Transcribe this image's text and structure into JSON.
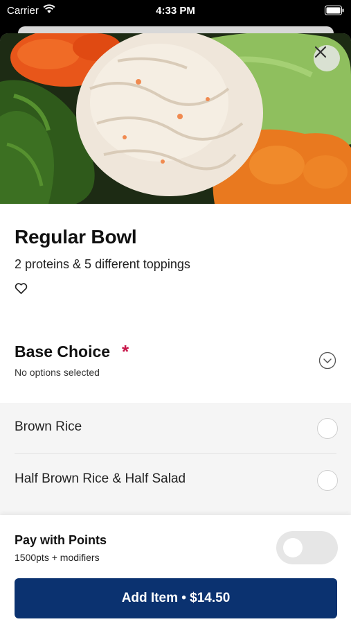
{
  "status_bar": {
    "carrier": "Carrier",
    "time": "4:33 PM"
  },
  "product": {
    "title": "Regular Bowl",
    "description": "2 proteins & 5 different toppings"
  },
  "base_choice": {
    "title": "Base Choice",
    "required_mark": "*",
    "subtitle": "No options selected",
    "options": [
      {
        "label": "Brown Rice",
        "selected": false
      },
      {
        "label": "Half Brown Rice & Half Salad",
        "selected": false
      }
    ]
  },
  "points": {
    "title": "Pay with Points",
    "subtitle": "1500pts + modifiers",
    "enabled": false
  },
  "add_button": {
    "label": "Add Item • $14.50"
  },
  "colors": {
    "primary": "#0b3270",
    "required": "#c8174a"
  },
  "icons": {
    "close": "close-icon",
    "favorite": "heart-outline-icon",
    "expand": "chevron-down-circle-icon"
  }
}
